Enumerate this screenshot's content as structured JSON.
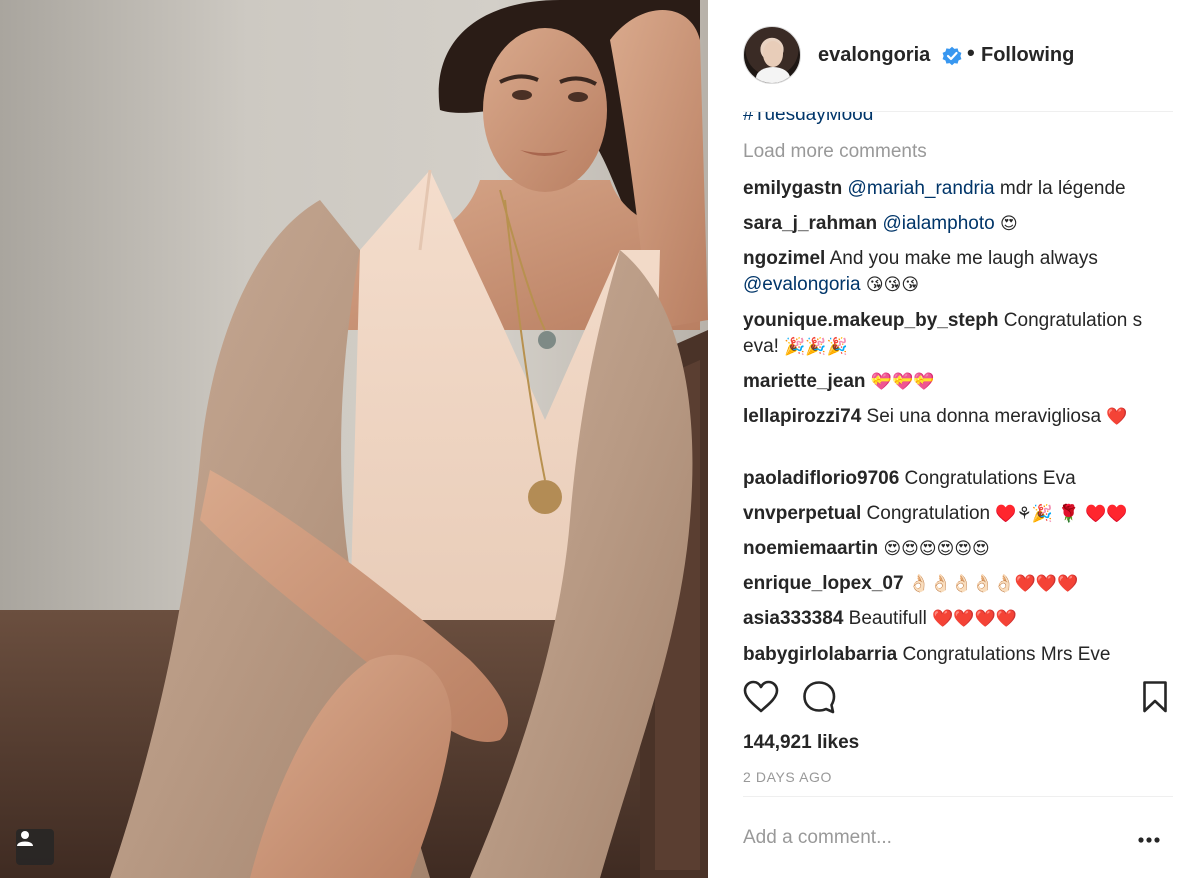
{
  "post": {
    "username": "evalongoria",
    "follow_status": "Following",
    "dot_separator": "•",
    "verified_icon": "verified-badge-icon",
    "caption_tail": "#TuesdayMood",
    "load_more": "Load more comments",
    "likes": "144,921 likes",
    "time_ago": "2 DAYS AGO",
    "add_comment_placeholder": "Add a comment...",
    "comments": [
      {
        "author": "emilygastn",
        "mention": "@mariah_randria",
        "text": " mdr la légende",
        "emoji": ""
      },
      {
        "author": "sara_j_rahman",
        "mention": "@ialamphoto",
        "text": " ",
        "emoji": "😍"
      },
      {
        "author": "ngozimel",
        "mention": "",
        "text": " And you make me laugh  always ",
        "mention2": "@evalongoria",
        "emoji": " 😘😘😘"
      },
      {
        "author": "younique.makeup_by_steph",
        "mention": "",
        "text": " Congratulation s eva! ",
        "emoji": "🎉🎉🎉"
      },
      {
        "author": "mariette_jean",
        "mention": "",
        "text": " ",
        "emoji": "💝💝💝"
      },
      {
        "author": "lellapirozzi74",
        "mention": "",
        "text": " Sei una donna meravigliosa ",
        "emoji": "❤️"
      },
      {
        "author": "paoladiflorio9706",
        "mention": "",
        "text": " Congratulations Eva",
        "emoji": ""
      },
      {
        "author": "vnvperpetual",
        "mention": "",
        "text": " Congratulation ",
        "emoji": "♥️⚘🎉 🌹 ♥️♥️"
      },
      {
        "author": "noemiemaartin",
        "mention": "",
        "text": " ",
        "emoji": "😍😍😍😍😍😍"
      },
      {
        "author": "enrique_lopex_07",
        "mention": "",
        "text": " ",
        "emoji": "👌🏻👌🏻👌🏻👌🏻👌🏻❤️❤️❤️"
      },
      {
        "author": "asia333384",
        "mention": "",
        "text": " Beautifull ",
        "emoji": "❤️❤️❤️❤️"
      },
      {
        "author": "babygirlolabarria",
        "mention": "",
        "text": " Congratulations Mrs Eve",
        "emoji": ""
      }
    ]
  },
  "icons": {
    "like": "heart-icon",
    "comment": "speech-bubble-icon",
    "save": "bookmark-icon",
    "more": "more-options-icon",
    "tag": "user-tag-icon"
  },
  "colors": {
    "text": "#262626",
    "muted": "#999999",
    "mention": "#003569",
    "verified": "#3897f0",
    "divider": "#efefef"
  }
}
